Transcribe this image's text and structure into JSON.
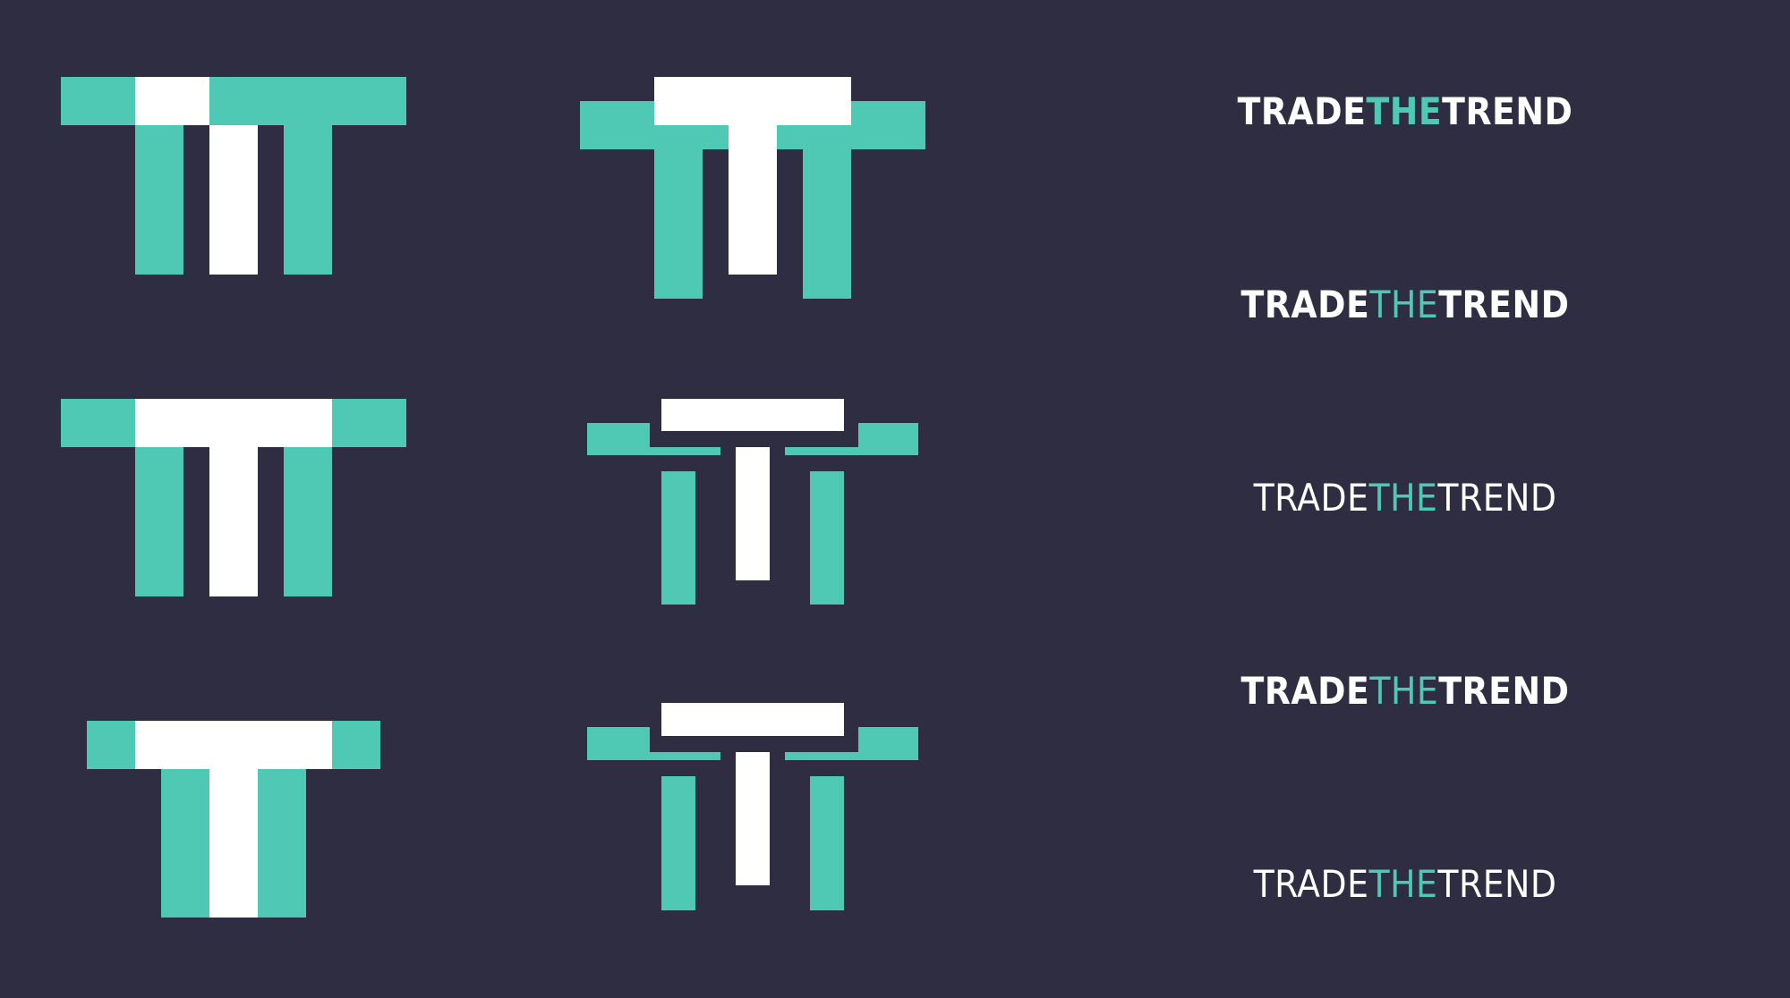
{
  "colors": {
    "background": "#2e2d42",
    "teal": "#4fc8b4",
    "white": "#ffffff"
  },
  "wordmarks": [
    {
      "part1": "TRADE",
      "part2": "THE",
      "part3": "TREND",
      "style": "black"
    },
    {
      "part1": "TRADE",
      "part2": "THE",
      "part3": "TREND",
      "style": "bold"
    },
    {
      "part1": "TRADE",
      "part2": "THE",
      "part3": "TREND",
      "style": "medium"
    },
    {
      "part1": "TRADE",
      "part2": "THE",
      "part3": "TREND",
      "style": "bold-light-middle"
    },
    {
      "part1": "TRADE",
      "part2": "THE",
      "part3": "TREND",
      "style": "light"
    }
  ]
}
